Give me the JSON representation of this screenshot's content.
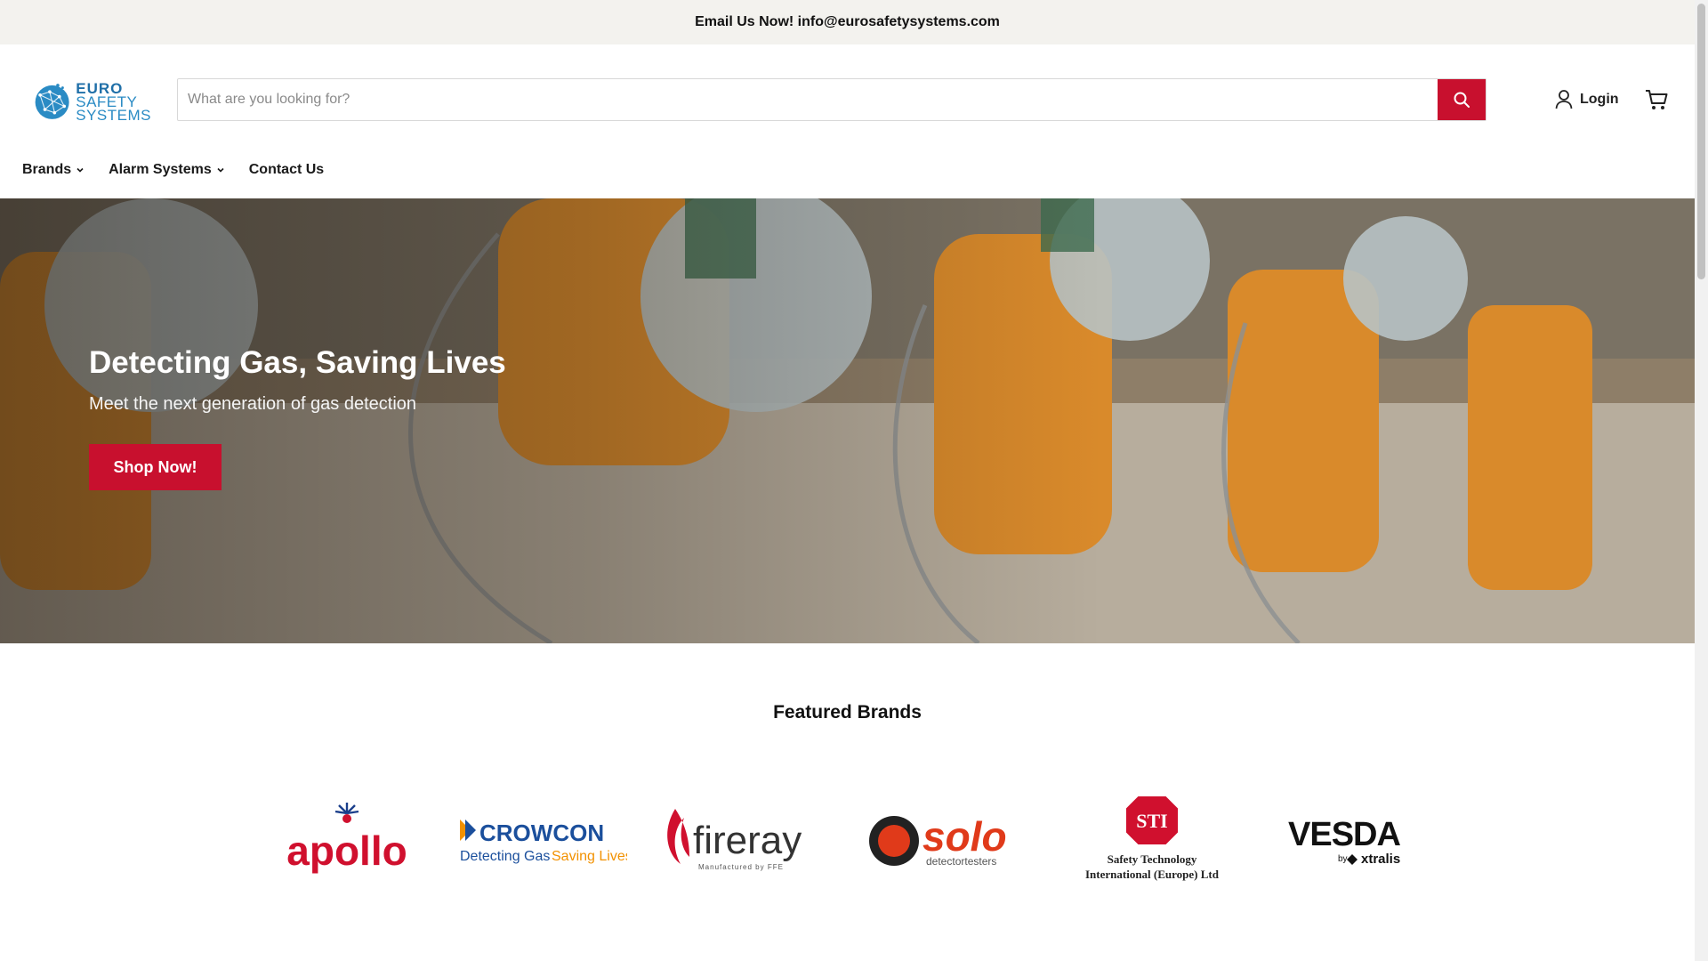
{
  "announcement": {
    "text": "Email Us Now! info@eurosafetysystems.com"
  },
  "logo": {
    "line1": "EURO",
    "line2": "SAFETY",
    "line3": "SYSTEMS"
  },
  "search": {
    "placeholder": "What are you looking for?",
    "value": "",
    "button_icon": "search-icon"
  },
  "account": {
    "login_label": "Login",
    "login_icon": "user-icon",
    "cart_icon": "cart-icon"
  },
  "nav": {
    "items": [
      {
        "label": "Brands",
        "has_dropdown": true
      },
      {
        "label": "Alarm Systems",
        "has_dropdown": true
      },
      {
        "label": "Contact Us",
        "has_dropdown": false
      }
    ]
  },
  "hero": {
    "title": "Detecting Gas, Saving Lives",
    "subtitle": "Meet the next generation of gas detection",
    "cta_label": "Shop Now!"
  },
  "featured": {
    "title": "Featured Brands",
    "brands": [
      {
        "name": "apollo"
      },
      {
        "name": "CROWCON",
        "tagline_1": "Detecting Gas",
        "tagline_2": "Saving Lives"
      },
      {
        "name": "fireray",
        "tagline": "Manufactured by FFE"
      },
      {
        "name": "solo",
        "tagline": "detectortesters"
      },
      {
        "name": "STI",
        "tagline_1": "Safety Technology",
        "tagline_2": "International (Europe) Ltd"
      },
      {
        "name": "VESDA",
        "tagline_1": "by",
        "tagline_2": "xtralis"
      }
    ]
  },
  "colors": {
    "accent": "#c8102e",
    "announcement_bg": "#f3f2ee",
    "logo_blue": "#1f6fa8"
  }
}
